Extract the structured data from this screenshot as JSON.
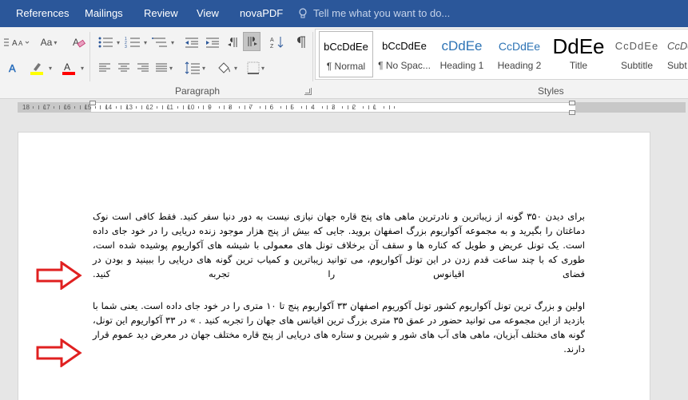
{
  "menu": {
    "items": [
      "References",
      "Mailings",
      "Review",
      "View",
      "novaPDF"
    ],
    "tell_me": "Tell me what you want to do..."
  },
  "ribbon": {
    "paragraph_label": "Paragraph",
    "styles_label": "Styles",
    "font_size_label": "Aa",
    "colors": {
      "highlight": "#ffff00",
      "font_color": "#ff0000"
    },
    "styles": [
      {
        "preview": "bCcDdEe",
        "name": "¶ Normal",
        "selected": true
      },
      {
        "preview": "bCcDdEe",
        "name": "¶ No Spac..."
      },
      {
        "preview": "cDdEe",
        "name": "Heading 1"
      },
      {
        "preview": "CcDdEe",
        "name": "Heading 2"
      },
      {
        "preview": "DdEe",
        "name": "Title"
      },
      {
        "preview": "CcDdEe",
        "name": "Subtitle"
      },
      {
        "preview": "CcDd",
        "name": "Subt"
      }
    ]
  },
  "ruler": {
    "numbers": [
      "18",
      "17",
      "16",
      "15",
      "14",
      "13",
      "12",
      "11",
      "10",
      "9",
      "8",
      "7",
      "6",
      "5",
      "4",
      "3",
      "2",
      "1"
    ]
  },
  "document": {
    "paragraphs": [
      "برای دیدن ۳۵۰ گونه از زیباترین و نادرترین ماهی های پنج قاره جهان نیازی نیست به دور دنیا سفر کنید. فقط کافی است نوک دماغتان را بگیرید و به مجموعه آکواریوم بزرگ اصفهان بروید. جایی که بیش از پنج هزار موجود زنده دریایی را در خود جای داده است. یک تونل عریض و طویل که کناره ها و سقف آن برخلاف تونل های معمولی با شیشه های آکواریوم پوشیده شده است، طوری که با چند ساعت قدم زدن در این تونل آکواریوم، می توانید زیباترین و کمیاب ترین گونه های دریایی را ببینید و بودن در فضای اقیانوس را تجربه کنید.",
      "اولین و بزرگ ترین تونل آکواریوم کشور تونل آکوریوم اصفهان ۳۳ آکواریوم پنج تا ۱۰ متری را در خود جای داده است. یعنی شما با بازدید از این مجموعه می توانید حضور در عمق ۳۵ متری بزرگ ترین اقیانس های جهان را تجربه کنید . » در ۳۳ آکواریوم این تونل، گونه های مختلف آبزیان، ماهی های آب های شور و شیرین و ستاره های دریایی از پنج قاره مختلف جهان در معرض دید عموم قرار دارند."
    ],
    "annotation_color": "#e02020"
  }
}
